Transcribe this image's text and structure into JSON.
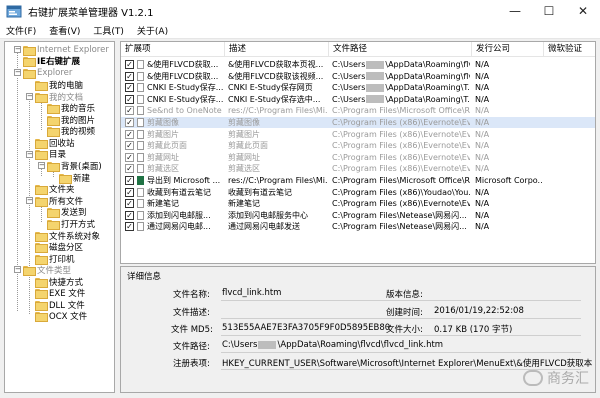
{
  "window": {
    "title": "右键扩展菜单管理器 V1.2.1",
    "controls": {
      "minimize": "—",
      "maximize": "☐",
      "close": "✕"
    }
  },
  "menubar": [
    "文件(F)",
    "查看(V)",
    "工具(T)",
    "关于(A)"
  ],
  "tree": [
    {
      "label": "Internet Explorer",
      "style": "gray"
    },
    {
      "label": "IE右键扩展",
      "style": "bold"
    },
    {
      "label": "Explorer",
      "style": "gray"
    },
    {
      "label": "我的电脑",
      "style": ""
    },
    {
      "label": "我的文档",
      "style": "gray"
    },
    {
      "label": "我的音乐",
      "style": ""
    },
    {
      "label": "我的图片",
      "style": ""
    },
    {
      "label": "我的视频",
      "style": ""
    },
    {
      "label": "回收站",
      "style": ""
    },
    {
      "label": "目录",
      "style": ""
    },
    {
      "label": "背景(桌面)",
      "style": ""
    },
    {
      "label": "新建",
      "style": ""
    },
    {
      "label": "文件夹",
      "style": ""
    },
    {
      "label": "所有文件",
      "style": ""
    },
    {
      "label": "发送到",
      "style": ""
    },
    {
      "label": "打开方式",
      "style": ""
    },
    {
      "label": "文件系统对象",
      "style": ""
    },
    {
      "label": "磁盘分区",
      "style": ""
    },
    {
      "label": "打印机",
      "style": ""
    },
    {
      "label": "文件类型",
      "style": "gray"
    },
    {
      "label": "快捷方式",
      "style": ""
    },
    {
      "label": "EXE 文件",
      "style": ""
    },
    {
      "label": "DLL 文件",
      "style": ""
    },
    {
      "label": "OCX 文件",
      "style": ""
    }
  ],
  "table": {
    "columns": [
      "扩展项",
      "描述",
      "文件路径",
      "发行公司",
      "微软验证"
    ],
    "rows": [
      {
        "checked": true,
        "gray": false,
        "selected": false,
        "icon": "file",
        "name": "&使用FLVCD获取...",
        "desc": "&使用FLVCD获取本页视...",
        "path_pre": "C:\\Users",
        "path_post": "\\AppData\\Roaming\\flv...",
        "company": "N/A",
        "verify": ""
      },
      {
        "checked": true,
        "gray": false,
        "selected": false,
        "icon": "file",
        "name": "&使用FLVCD获取...",
        "desc": "&使用FLVCD获取该视频...",
        "path_pre": "C:\\Users",
        "path_post": "\\AppData\\Roaming\\flv...",
        "company": "N/A",
        "verify": ""
      },
      {
        "checked": true,
        "gray": false,
        "selected": false,
        "icon": "file",
        "name": "CNKI E-Study保存...",
        "desc": "CNKI E-Study保存网页",
        "path_pre": "C:\\Users",
        "path_post": "\\AppData\\Roaming\\T...",
        "company": "N/A",
        "verify": ""
      },
      {
        "checked": true,
        "gray": false,
        "selected": false,
        "icon": "file",
        "name": "CNKI E-Study保存...",
        "desc": "CNKI E-Study保存选中...",
        "path_pre": "C:\\Users",
        "path_post": "\\AppData\\Roaming\\T...",
        "company": "N/A",
        "verify": ""
      },
      {
        "checked": true,
        "gray": true,
        "selected": false,
        "icon": "file",
        "name": "Se&nd to OneNote",
        "desc": "res://C:\\Program Files\\Mi...",
        "path_pre": "C:\\Program Files\\Microsoft Office\\Ro...",
        "path_post": "",
        "company": "N/A",
        "verify": ""
      },
      {
        "checked": true,
        "gray": true,
        "selected": true,
        "icon": "file",
        "name": "剪藏图像",
        "desc": "剪藏图像",
        "path_pre": "C:\\Program Files (x86)\\Evernote\\Eve...",
        "path_post": "",
        "company": "N/A",
        "verify": ""
      },
      {
        "checked": true,
        "gray": true,
        "selected": false,
        "icon": "file",
        "name": "剪藏图片",
        "desc": "剪藏图片",
        "path_pre": "C:\\Program Files (x86)\\Evernote\\Eve...",
        "path_post": "",
        "company": "N/A",
        "verify": ""
      },
      {
        "checked": true,
        "gray": true,
        "selected": false,
        "icon": "file",
        "name": "剪藏此页面",
        "desc": "剪藏此页面",
        "path_pre": "C:\\Program Files (x86)\\Evernote\\Eve...",
        "path_post": "",
        "company": "N/A",
        "verify": ""
      },
      {
        "checked": true,
        "gray": true,
        "selected": false,
        "icon": "file",
        "name": "剪藏网址",
        "desc": "剪藏网址",
        "path_pre": "C:\\Program Files (x86)\\Evernote\\Eve...",
        "path_post": "",
        "company": "N/A",
        "verify": ""
      },
      {
        "checked": true,
        "gray": true,
        "selected": false,
        "icon": "file",
        "name": "剪藏选区",
        "desc": "剪藏选区",
        "path_pre": "C:\\Program Files (x86)\\Evernote\\Eve...",
        "path_post": "",
        "company": "N/A",
        "verify": ""
      },
      {
        "checked": true,
        "gray": false,
        "selected": false,
        "icon": "excel",
        "name": "导出到 Microsoft ...",
        "desc": "res://C:\\Program Files\\Mi...",
        "path_pre": "C:\\Program Files\\Microsoft Office\\Ro...",
        "path_post": "",
        "company": "Microsoft Corpo...",
        "verify": ""
      },
      {
        "checked": true,
        "gray": false,
        "selected": false,
        "icon": "file",
        "name": "收藏到有道云笔记",
        "desc": "收藏到有道云笔记",
        "path_pre": "C:\\Program Files (x86)\\Youdao\\You...",
        "path_post": "",
        "company": "N/A",
        "verify": ""
      },
      {
        "checked": true,
        "gray": false,
        "selected": false,
        "icon": "file",
        "name": "新建笔记",
        "desc": "新建笔记",
        "path_pre": "C:\\Program Files (x86)\\Evernote\\Eve...",
        "path_post": "",
        "company": "N/A",
        "verify": ""
      },
      {
        "checked": true,
        "gray": false,
        "selected": false,
        "icon": "file",
        "name": "添加到闪电邮服...",
        "desc": "添加到闪电邮服务中心",
        "path_pre": "C:\\Program Files\\Netease\\网易闪...",
        "path_post": "",
        "company": "N/A",
        "verify": ""
      },
      {
        "checked": true,
        "gray": false,
        "selected": false,
        "icon": "file",
        "name": "通过网易闪电邮...",
        "desc": "通过网易闪电邮发送",
        "path_pre": "C:\\Program Files\\Netease\\网易闪...",
        "path_post": "",
        "company": "N/A",
        "verify": ""
      }
    ]
  },
  "details": {
    "heading": "详细信息",
    "file_name_label": "文件名称:",
    "file_name": "flvcd_link.htm",
    "version_label": "版本信息:",
    "version": "",
    "file_desc_label": "文件描述:",
    "file_desc": "",
    "created_label": "创建时间:",
    "created": "2016/01/19,22:52:08",
    "md5_label": "文件 MD5:",
    "md5": "513E55AAE7E3FA3705F9F0D5895EB80",
    "size_label": "文件大小:",
    "size": "0.17 KB (170 字节)",
    "path_label": "文件路径:",
    "path_pre": "C:\\Users",
    "path_post": "\\AppData\\Roaming\\flvcd\\flvcd_link.htm",
    "reg_label": "注册表项:",
    "reg": "HKEY_CURRENT_USER\\Software\\Microsoft\\Internet Explorer\\MenuExt\\&使用FLVCD获取本页视频的下载地址"
  },
  "watermark": "商务汇"
}
